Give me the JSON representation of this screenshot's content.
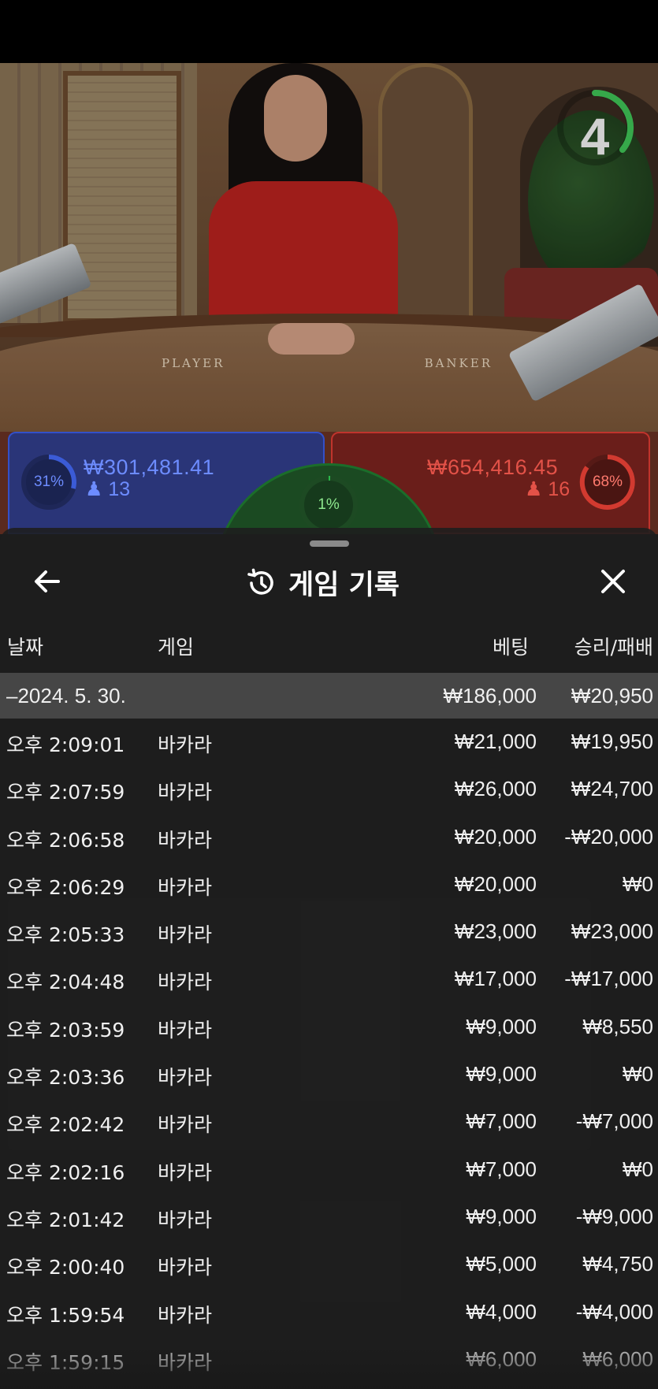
{
  "video": {
    "table_player_label": "PLAYER",
    "table_banker_label": "BANKER",
    "countdown": "4"
  },
  "bets": {
    "player": {
      "percent": "31%",
      "amount": "₩301,481.41",
      "players": "13",
      "color": "#3b5bd6"
    },
    "banker": {
      "percent": "68%",
      "amount": "₩654,416.45",
      "players": "16",
      "color": "#d23a30"
    },
    "tie": {
      "percent": "1%",
      "color": "#2bb84a"
    }
  },
  "history": {
    "title": "게임 기록",
    "icons": {
      "back": "arrow-left-icon",
      "history": "history-icon",
      "close": "close-icon"
    },
    "columns": {
      "date": "날짜",
      "game": "게임",
      "bet": "베팅",
      "result": "승리/패배"
    },
    "summary": {
      "date": "–2024. 5. 30.",
      "bet": "₩186,000",
      "result": "₩20,950"
    },
    "rows": [
      {
        "time": "오후 2:09:01",
        "game": "바카라",
        "bet": "₩21,000",
        "result": "₩19,950"
      },
      {
        "time": "오후 2:07:59",
        "game": "바카라",
        "bet": "₩26,000",
        "result": "₩24,700"
      },
      {
        "time": "오후 2:06:58",
        "game": "바카라",
        "bet": "₩20,000",
        "result": "-₩20,000"
      },
      {
        "time": "오후 2:06:29",
        "game": "바카라",
        "bet": "₩20,000",
        "result": "₩0"
      },
      {
        "time": "오후 2:05:33",
        "game": "바카라",
        "bet": "₩23,000",
        "result": "₩23,000"
      },
      {
        "time": "오후 2:04:48",
        "game": "바카라",
        "bet": "₩17,000",
        "result": "-₩17,000"
      },
      {
        "time": "오후 2:03:59",
        "game": "바카라",
        "bet": "₩9,000",
        "result": "₩8,550"
      },
      {
        "time": "오후 2:03:36",
        "game": "바카라",
        "bet": "₩9,000",
        "result": "₩0"
      },
      {
        "time": "오후 2:02:42",
        "game": "바카라",
        "bet": "₩7,000",
        "result": "-₩7,000"
      },
      {
        "time": "오후 2:02:16",
        "game": "바카라",
        "bet": "₩7,000",
        "result": "₩0"
      },
      {
        "time": "오후 2:01:42",
        "game": "바카라",
        "bet": "₩9,000",
        "result": "-₩9,000"
      },
      {
        "time": "오후 2:00:40",
        "game": "바카라",
        "bet": "₩5,000",
        "result": "₩4,750"
      },
      {
        "time": "오후 1:59:54",
        "game": "바카라",
        "bet": "₩4,000",
        "result": "-₩4,000"
      },
      {
        "time": "오후 1:59:15",
        "game": "바카라",
        "bet": "₩6,000",
        "result": "₩6,000"
      }
    ]
  }
}
